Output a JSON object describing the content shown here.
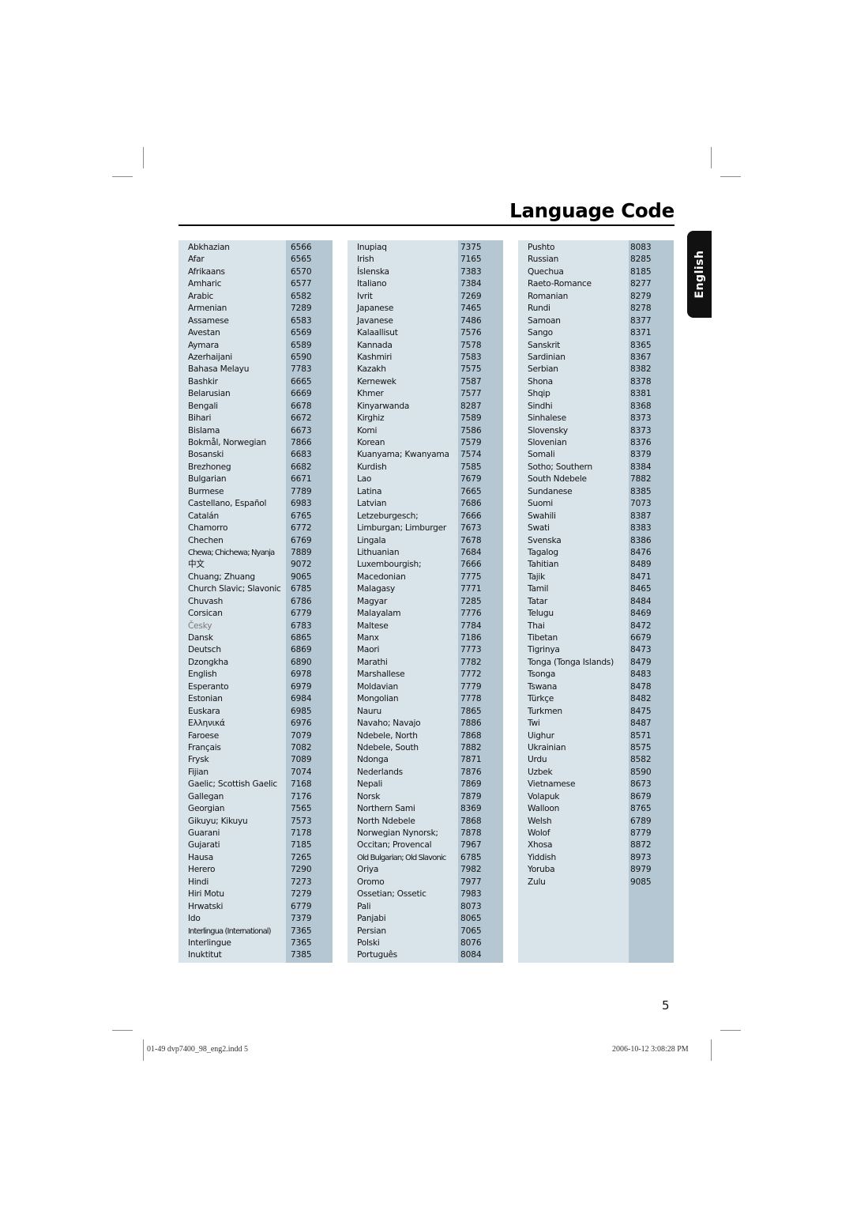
{
  "title": "Language Code",
  "side_tab": "English",
  "page_number": "5",
  "footer": {
    "file": "01-49 dvp7400_98_eng2.indd   5",
    "timestamp": "2006-10-12   3:08:28 PM"
  },
  "columns": [
    [
      {
        "name": "Abkhazian",
        "code": "6566"
      },
      {
        "name": "Afar",
        "code": "6565"
      },
      {
        "name": "Afrikaans",
        "code": "6570"
      },
      {
        "name": "Amharic",
        "code": "6577"
      },
      {
        "name": "Arabic",
        "code": "6582"
      },
      {
        "name": "Armenian",
        "code": "7289"
      },
      {
        "name": "Assamese",
        "code": "6583"
      },
      {
        "name": "Avestan",
        "code": "6569"
      },
      {
        "name": "Aymara",
        "code": "6589"
      },
      {
        "name": "Azerhaijani",
        "code": "6590"
      },
      {
        "name": "Bahasa Melayu",
        "code": "7783"
      },
      {
        "name": "Bashkir",
        "code": "6665"
      },
      {
        "name": "Belarusian",
        "code": "6669"
      },
      {
        "name": "Bengali",
        "code": "6678"
      },
      {
        "name": "Bihari",
        "code": "6672"
      },
      {
        "name": "Bislama",
        "code": "6673"
      },
      {
        "name": "Bokmål, Norwegian",
        "code": "7866"
      },
      {
        "name": "Bosanski",
        "code": "6683"
      },
      {
        "name": "Brezhoneg",
        "code": "6682"
      },
      {
        "name": "Bulgarian",
        "code": "6671"
      },
      {
        "name": "Burmese",
        "code": "7789"
      },
      {
        "name": "Castellano, Español",
        "code": "6983"
      },
      {
        "name": "Catalán",
        "code": "6765"
      },
      {
        "name": "Chamorro",
        "code": "6772"
      },
      {
        "name": "Chechen",
        "code": "6769"
      },
      {
        "name": "Chewa; Chichewa; Nyanja",
        "code": "7889",
        "style": "condensed"
      },
      {
        "name": "中文",
        "code": "9072"
      },
      {
        "name": "Chuang; Zhuang",
        "code": "9065"
      },
      {
        "name": "Church Slavic; Slavonic",
        "code": "6785"
      },
      {
        "name": "Chuvash",
        "code": "6786"
      },
      {
        "name": "Corsican",
        "code": "6779"
      },
      {
        "name": "Česky",
        "code": "6783",
        "style": "light"
      },
      {
        "name": "Dansk",
        "code": "6865"
      },
      {
        "name": "Deutsch",
        "code": "6869"
      },
      {
        "name": "Dzongkha",
        "code": "6890"
      },
      {
        "name": "English",
        "code": "6978"
      },
      {
        "name": "Esperanto",
        "code": "6979"
      },
      {
        "name": "Estonian",
        "code": "6984"
      },
      {
        "name": "Euskara",
        "code": "6985"
      },
      {
        "name": "Ελληνικά",
        "code": "6976"
      },
      {
        "name": "Faroese",
        "code": "7079"
      },
      {
        "name": "Français",
        "code": "7082"
      },
      {
        "name": "Frysk",
        "code": "7089"
      },
      {
        "name": "Fijian",
        "code": "7074"
      },
      {
        "name": "Gaelic; Scottish Gaelic",
        "code": "7168"
      },
      {
        "name": "Gallegan",
        "code": "7176"
      },
      {
        "name": "Georgian",
        "code": "7565"
      },
      {
        "name": "Gikuyu; Kikuyu",
        "code": "7573"
      },
      {
        "name": "Guarani",
        "code": "7178"
      },
      {
        "name": "Gujarati",
        "code": "7185"
      },
      {
        "name": "Hausa",
        "code": "7265"
      },
      {
        "name": "Herero",
        "code": "7290"
      },
      {
        "name": "Hindi",
        "code": "7273"
      },
      {
        "name": "Hiri Motu",
        "code": "7279"
      },
      {
        "name": "Hrwatski",
        "code": "6779"
      },
      {
        "name": "Ido",
        "code": "7379"
      },
      {
        "name": "Interlingua (International)",
        "code": "7365",
        "style": "condensed"
      },
      {
        "name": "Interlingue",
        "code": "7365"
      },
      {
        "name": "Inuktitut",
        "code": "7385"
      }
    ],
    [
      {
        "name": "Inupiaq",
        "code": "7375"
      },
      {
        "name": "Irish",
        "code": "7165"
      },
      {
        "name": "Íslenska",
        "code": "7383"
      },
      {
        "name": "Italiano",
        "code": "7384"
      },
      {
        "name": "Ivrit",
        "code": "7269"
      },
      {
        "name": "Japanese",
        "code": "7465"
      },
      {
        "name": "Javanese",
        "code": "7486"
      },
      {
        "name": "Kalaallisut",
        "code": "7576"
      },
      {
        "name": "Kannada",
        "code": "7578"
      },
      {
        "name": "Kashmiri",
        "code": "7583"
      },
      {
        "name": "Kazakh",
        "code": "7575"
      },
      {
        "name": "Kernewek",
        "code": "7587"
      },
      {
        "name": "Khmer",
        "code": "7577"
      },
      {
        "name": "Kinyarwanda",
        "code": "8287"
      },
      {
        "name": "Kirghiz",
        "code": "7589"
      },
      {
        "name": "Komi",
        "code": "7586"
      },
      {
        "name": "Korean",
        "code": "7579"
      },
      {
        "name": "Kuanyama; Kwanyama",
        "code": "7574"
      },
      {
        "name": "Kurdish",
        "code": "7585"
      },
      {
        "name": "Lao",
        "code": "7679"
      },
      {
        "name": "Latina",
        "code": "7665"
      },
      {
        "name": "Latvian",
        "code": "7686"
      },
      {
        "name": "Letzeburgesch;",
        "code": "7666"
      },
      {
        "name": "Limburgan; Limburger",
        "code": "7673"
      },
      {
        "name": "Lingala",
        "code": "7678"
      },
      {
        "name": "Lithuanian",
        "code": "7684"
      },
      {
        "name": "Luxembourgish;",
        "code": "7666"
      },
      {
        "name": "Macedonian",
        "code": "7775"
      },
      {
        "name": "Malagasy",
        "code": "7771"
      },
      {
        "name": "Magyar",
        "code": "7285"
      },
      {
        "name": "Malayalam",
        "code": "7776"
      },
      {
        "name": "Maltese",
        "code": "7784"
      },
      {
        "name": "Manx",
        "code": "7186"
      },
      {
        "name": "Maori",
        "code": "7773"
      },
      {
        "name": "Marathi",
        "code": "7782"
      },
      {
        "name": "Marshallese",
        "code": "7772"
      },
      {
        "name": "Moldavian",
        "code": "7779"
      },
      {
        "name": "Mongolian",
        "code": "7778"
      },
      {
        "name": "Nauru",
        "code": "7865"
      },
      {
        "name": "Navaho; Navajo",
        "code": "7886"
      },
      {
        "name": "Ndebele, North",
        "code": "7868"
      },
      {
        "name": "Ndebele, South",
        "code": "7882"
      },
      {
        "name": "Ndonga",
        "code": "7871"
      },
      {
        "name": "Nederlands",
        "code": "7876"
      },
      {
        "name": "Nepali",
        "code": "7869"
      },
      {
        "name": "Norsk",
        "code": "7879"
      },
      {
        "name": "Northern Sami",
        "code": "8369"
      },
      {
        "name": "North Ndebele",
        "code": "7868"
      },
      {
        "name": "Norwegian Nynorsk;",
        "code": "7878"
      },
      {
        "name": "Occitan; Provencal",
        "code": "7967"
      },
      {
        "name": "Old Bulgarian; Old Slavonic",
        "code": "6785",
        "style": "condensed"
      },
      {
        "name": "Oriya",
        "code": "7982"
      },
      {
        "name": "Oromo",
        "code": "7977"
      },
      {
        "name": "Ossetian; Ossetic",
        "code": "7983"
      },
      {
        "name": "Pali",
        "code": "8073"
      },
      {
        "name": "Panjabi",
        "code": "8065"
      },
      {
        "name": "Persian",
        "code": "7065"
      },
      {
        "name": "Polski",
        "code": "8076"
      },
      {
        "name": "Português",
        "code": "8084"
      }
    ],
    [
      {
        "name": "Pushto",
        "code": "8083"
      },
      {
        "name": "Russian",
        "code": "8285"
      },
      {
        "name": "Quechua",
        "code": "8185"
      },
      {
        "name": "Raeto-Romance",
        "code": "8277"
      },
      {
        "name": "Romanian",
        "code": "8279"
      },
      {
        "name": "Rundi",
        "code": "8278"
      },
      {
        "name": "Samoan",
        "code": "8377"
      },
      {
        "name": "Sango",
        "code": "8371"
      },
      {
        "name": "Sanskrit",
        "code": "8365"
      },
      {
        "name": "Sardinian",
        "code": "8367"
      },
      {
        "name": "Serbian",
        "code": "8382"
      },
      {
        "name": "Shona",
        "code": "8378"
      },
      {
        "name": "Shqip",
        "code": "8381"
      },
      {
        "name": "Sindhi",
        "code": "8368"
      },
      {
        "name": "Sinhalese",
        "code": "8373"
      },
      {
        "name": "Slovensky",
        "code": "8373"
      },
      {
        "name": "Slovenian",
        "code": "8376"
      },
      {
        "name": "Somali",
        "code": "8379"
      },
      {
        "name": "Sotho; Southern",
        "code": "8384"
      },
      {
        "name": "South Ndebele",
        "code": "7882"
      },
      {
        "name": "Sundanese",
        "code": "8385"
      },
      {
        "name": "Suomi",
        "code": "7073"
      },
      {
        "name": "Swahili",
        "code": "8387"
      },
      {
        "name": "Swati",
        "code": "8383"
      },
      {
        "name": "Svenska",
        "code": "8386"
      },
      {
        "name": "Tagalog",
        "code": "8476"
      },
      {
        "name": "Tahitian",
        "code": "8489"
      },
      {
        "name": "Tajik",
        "code": "8471"
      },
      {
        "name": "Tamil",
        "code": "8465"
      },
      {
        "name": "Tatar",
        "code": "8484"
      },
      {
        "name": "Telugu",
        "code": "8469"
      },
      {
        "name": "Thai",
        "code": "8472"
      },
      {
        "name": "Tibetan",
        "code": "6679"
      },
      {
        "name": "Tigrinya",
        "code": "8473"
      },
      {
        "name": "Tonga (Tonga Islands)",
        "code": "8479"
      },
      {
        "name": "Tsonga",
        "code": "8483"
      },
      {
        "name": "Tswana",
        "code": "8478"
      },
      {
        "name": "Türkçe",
        "code": "8482"
      },
      {
        "name": "Turkmen",
        "code": "8475"
      },
      {
        "name": "Twi",
        "code": "8487"
      },
      {
        "name": "Uighur",
        "code": "8571"
      },
      {
        "name": "Ukrainian",
        "code": "8575"
      },
      {
        "name": "Urdu",
        "code": "8582"
      },
      {
        "name": "Uzbek",
        "code": "8590"
      },
      {
        "name": "Vietnamese",
        "code": "8673"
      },
      {
        "name": "Volapuk",
        "code": "8679"
      },
      {
        "name": "Walloon",
        "code": "8765"
      },
      {
        "name": "Welsh",
        "code": "6789"
      },
      {
        "name": "Wolof",
        "code": "8779"
      },
      {
        "name": "Xhosa",
        "code": "8872"
      },
      {
        "name": "Yiddish",
        "code": "8973"
      },
      {
        "name": "Yoruba",
        "code": "8979"
      },
      {
        "name": "Zulu",
        "code": "9085"
      }
    ]
  ]
}
